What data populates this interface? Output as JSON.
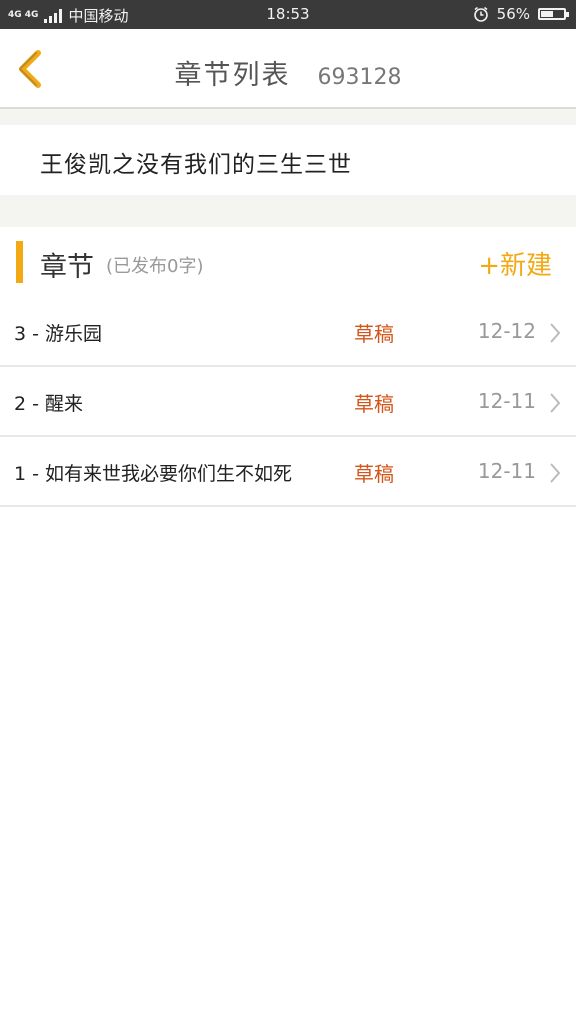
{
  "status_bar": {
    "network_label": "4G 4G",
    "carrier": "中国移动",
    "time": "18:53",
    "alarm_icon": "alarm-clock-icon",
    "battery_percent": "56%",
    "battery_level": 0.56
  },
  "header": {
    "back_icon": "chevron-left-icon",
    "title": "章节列表",
    "book_id": "693128"
  },
  "book": {
    "title": "王俊凯之没有我们的三生三世"
  },
  "section": {
    "label": "章节",
    "note": "(已发布0字)",
    "new_button": "+新建"
  },
  "chapters": [
    {
      "title": "3 - 游乐园",
      "status": "草稿",
      "date": "12-12"
    },
    {
      "title": "2 - 醒来",
      "status": "草稿",
      "date": "12-11"
    },
    {
      "title": "1 - 如有来世我必要你们生不如死",
      "status": "草稿",
      "date": "12-11"
    }
  ],
  "colors": {
    "accent": "#f3a914",
    "draft": "#d4541a",
    "status_bar_bg": "#3a3a3a",
    "divider_bg": "#f4f4f0"
  }
}
